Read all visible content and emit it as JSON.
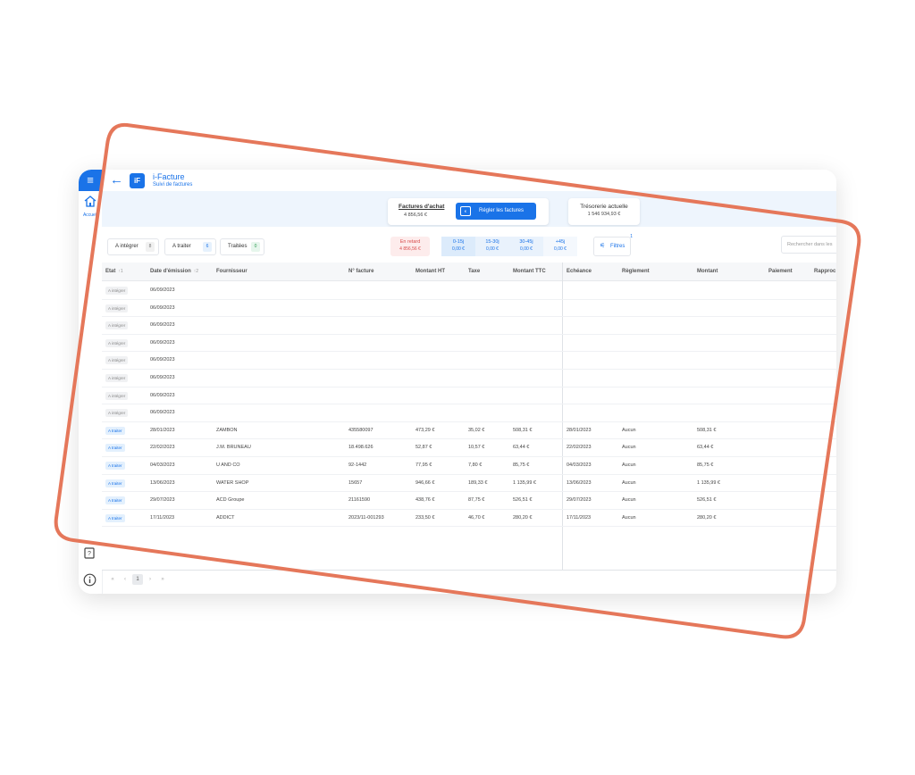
{
  "app": {
    "menu_icon": "menu-icon",
    "back_icon": "back-arrow-icon",
    "logo_text": "iF",
    "title": "i-Facture",
    "subtitle": "Suivi de factures"
  },
  "sidebar": {
    "home_label": "Accueil",
    "home_icon": "home-icon",
    "help_icon": "help-book-icon",
    "info_icon": "info-icon"
  },
  "summary": {
    "achat_label": "Factures d'achat",
    "achat_value": "4 856,56 €",
    "regler_label": "Régler les factures",
    "treso_label": "Trésorerie actuelle",
    "treso_value": "1 546 934,93 €"
  },
  "filters": {
    "status_pills": [
      {
        "label": "A intégrer",
        "count": "8"
      },
      {
        "label": "A traiter",
        "count": "6"
      },
      {
        "label": "Traitées",
        "count": "0"
      }
    ],
    "aging": [
      {
        "label": "En retard",
        "amount": "4 856,56 €"
      },
      {
        "label": "0-15j",
        "amount": "0,00 €"
      },
      {
        "label": "15-30j",
        "amount": "0,00 €"
      },
      {
        "label": "30-45j",
        "amount": "0,00 €"
      },
      {
        "label": "+45j",
        "amount": "0,00 €"
      }
    ],
    "filtres_label": "Filtres",
    "filtres_badge": "1",
    "search_placeholder": "Rechercher dans les"
  },
  "table": {
    "headers": {
      "etat": "Etat",
      "date_emission": "Date d'émission",
      "fournisseur": "Fournisseur",
      "num_facture": "N° facture",
      "montant_ht": "Montant HT",
      "taxe": "Taxe",
      "montant_ttc": "Montant TTC",
      "echeance": "Echéance",
      "reglement": "Règlement",
      "montant": "Montant",
      "paiement": "Paiement",
      "rapprochement": "Rapproc"
    },
    "sort_indicators": {
      "etat": "↑1",
      "date": "↑2"
    },
    "rows": [
      {
        "etat": "A intégrer",
        "date": "06/09/2023",
        "fournisseur": "",
        "num": "",
        "ht": "",
        "taxe": "",
        "ttc": "",
        "echeance": "",
        "reglement": "",
        "montant": ""
      },
      {
        "etat": "A intégrer",
        "date": "06/09/2023",
        "fournisseur": "",
        "num": "",
        "ht": "",
        "taxe": "",
        "ttc": "",
        "echeance": "",
        "reglement": "",
        "montant": ""
      },
      {
        "etat": "A intégrer",
        "date": "06/09/2023",
        "fournisseur": "",
        "num": "",
        "ht": "",
        "taxe": "",
        "ttc": "",
        "echeance": "",
        "reglement": "",
        "montant": ""
      },
      {
        "etat": "A intégrer",
        "date": "06/09/2023",
        "fournisseur": "",
        "num": "",
        "ht": "",
        "taxe": "",
        "ttc": "",
        "echeance": "",
        "reglement": "",
        "montant": ""
      },
      {
        "etat": "A intégrer",
        "date": "06/09/2023",
        "fournisseur": "",
        "num": "",
        "ht": "",
        "taxe": "",
        "ttc": "",
        "echeance": "",
        "reglement": "",
        "montant": ""
      },
      {
        "etat": "A intégrer",
        "date": "06/09/2023",
        "fournisseur": "",
        "num": "",
        "ht": "",
        "taxe": "",
        "ttc": "",
        "echeance": "",
        "reglement": "",
        "montant": ""
      },
      {
        "etat": "A intégrer",
        "date": "06/09/2023",
        "fournisseur": "",
        "num": "",
        "ht": "",
        "taxe": "",
        "ttc": "",
        "echeance": "",
        "reglement": "",
        "montant": ""
      },
      {
        "etat": "A intégrer",
        "date": "06/09/2023",
        "fournisseur": "",
        "num": "",
        "ht": "",
        "taxe": "",
        "ttc": "",
        "echeance": "",
        "reglement": "",
        "montant": ""
      },
      {
        "etat": "A traiter",
        "date": "28/01/2023",
        "fournisseur": "ZAMBON",
        "num": "435580097",
        "ht": "473,29 €",
        "taxe": "35,02 €",
        "ttc": "508,31 €",
        "echeance": "28/01/2023",
        "reglement": "Aucun",
        "montant": "508,31 €"
      },
      {
        "etat": "A traiter",
        "date": "22/02/2023",
        "fournisseur": "J.M. BRUNEAU",
        "num": "18.498.626",
        "ht": "52,87 €",
        "taxe": "10,57 €",
        "ttc": "63,44 €",
        "echeance": "22/02/2023",
        "reglement": "Aucun",
        "montant": "63,44 €"
      },
      {
        "etat": "A traiter",
        "date": "04/03/2023",
        "fournisseur": "U AND CO",
        "num": "92-1442",
        "ht": "77,95 €",
        "taxe": "7,80 €",
        "ttc": "85,75 €",
        "echeance": "04/03/2023",
        "reglement": "Aucun",
        "montant": "85,75 €"
      },
      {
        "etat": "A traiter",
        "date": "13/06/2023",
        "fournisseur": "WATER SHOP",
        "num": "15657",
        "ht": "946,66 €",
        "taxe": "189,33 €",
        "ttc": "1 135,99 €",
        "echeance": "13/06/2023",
        "reglement": "Aucun",
        "montant": "1 135,99 €"
      },
      {
        "etat": "A traiter",
        "date": "29/07/2023",
        "fournisseur": "ACD Groupe",
        "num": "21161590",
        "ht": "438,76 €",
        "taxe": "87,75 €",
        "ttc": "526,51 €",
        "echeance": "29/07/2023",
        "reglement": "Aucun",
        "montant": "526,51 €"
      },
      {
        "etat": "A traiter",
        "date": "17/11/2023",
        "fournisseur": "ADDICT",
        "num": "2023/11-001293",
        "ht": "233,50 €",
        "taxe": "46,70 €",
        "ttc": "280,20 €",
        "echeance": "17/11/2023",
        "reglement": "Aucun",
        "montant": "280,20 €"
      }
    ]
  },
  "pagination": {
    "first": "«",
    "prev": "‹",
    "current": "1",
    "next": "›",
    "last": "»"
  },
  "colors": {
    "accent": "#1a73e8",
    "frame_stroke": "#e5775a",
    "overdue": "#d84a4a"
  }
}
